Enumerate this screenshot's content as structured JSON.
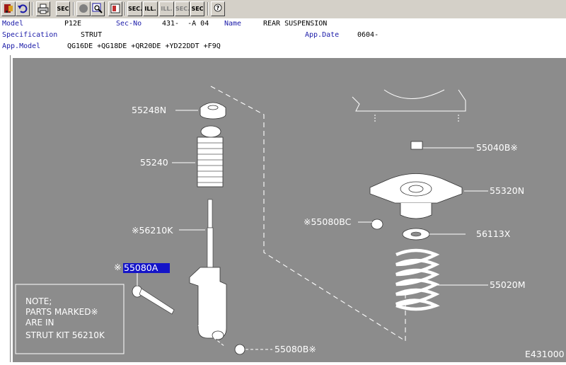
{
  "toolbar": {
    "buttons": [
      {
        "name": "exit-icon",
        "text": ""
      },
      {
        "name": "undo-icon",
        "text": ""
      },
      {
        "name": "print-icon",
        "text": ""
      },
      {
        "name": "sec-list-icon",
        "text": "SEC"
      },
      {
        "name": "record-icon",
        "text": ""
      },
      {
        "name": "search-icon",
        "text": ""
      },
      {
        "name": "catalog-icon",
        "text": ""
      },
      {
        "name": "prev-sec-icon",
        "text": "SEC."
      },
      {
        "name": "prev-ill-icon",
        "text": "ILL."
      },
      {
        "name": "next-ill-icon",
        "text": "ILL."
      },
      {
        "name": "next-sec-icon",
        "text": "SEC."
      },
      {
        "name": "sec-jump-icon",
        "text": "SEC"
      },
      {
        "name": "help-icon",
        "text": ""
      }
    ]
  },
  "header": {
    "model_label": "Model",
    "model_value": "P12E",
    "secno_label": "Sec-No",
    "secno_value": "431-  -A 04",
    "name_label": "Name",
    "name_value": "REAR SUSPENSION",
    "spec_label": "Specification",
    "spec_value": "STRUT",
    "appdate_label": "App.Date",
    "appdate_value": "0604-",
    "appmodel_label": "App.Model",
    "appmodel_value": "QG16DE +QG18DE +QR20DE +YD22DDT +F9Q"
  },
  "diagram": {
    "parts": {
      "p55248N": "55248N",
      "p55240": "55240",
      "p56210K": "※56210K",
      "p55080A": "55080A",
      "p55040B": "55040B※",
      "p55320N": "55320N",
      "p55080BC": "※55080BC",
      "p56113X": "56113X",
      "p55020M": "55020M",
      "p55080B": "55080B※"
    },
    "selected_prefix": "※",
    "note": {
      "line1": "NOTE;",
      "line2": "PARTS MARKED※",
      "line3": "ARE IN",
      "line4": "STRUT KIT 56210K"
    },
    "illustration_id": "E431000"
  },
  "colors": {
    "canvas": "#8c8c8c",
    "selection": "#1414c8",
    "label": "#1a1aa8"
  }
}
